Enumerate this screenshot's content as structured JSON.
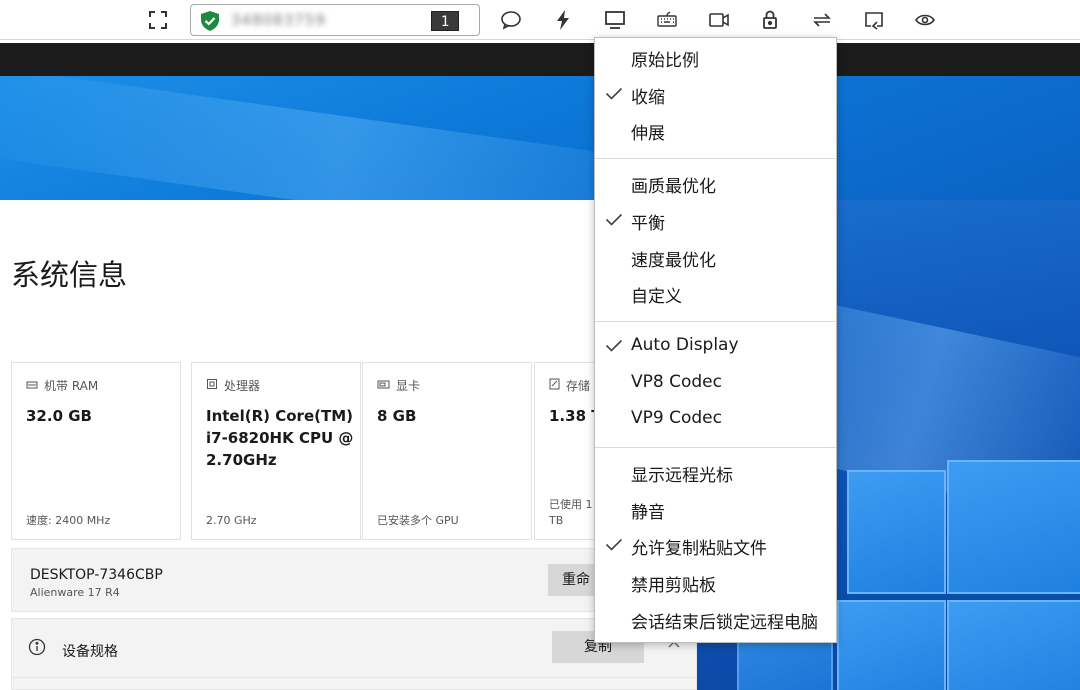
{
  "toolbar": {
    "peer_id": "348083759",
    "display_count": "1"
  },
  "settings": {
    "title": "系统信息",
    "cards": [
      {
        "head": "机带 RAM",
        "value": "32.0 GB",
        "foot": "速度: 2400 MHz"
      },
      {
        "head": "处理器",
        "value": "Intel(R) Core(TM) i7-6820HK CPU @ 2.70GHz",
        "foot": "2.70 GHz"
      },
      {
        "head": "显卡",
        "value": "8 GB",
        "foot": "已安装多个 GPU"
      },
      {
        "head": "存储",
        "value": "1.38 T",
        "foot": "已使用 1 TB"
      }
    ],
    "device": {
      "name": "DESKTOP-7346CBP",
      "model": "Alienware 17 R4",
      "rename_button": "重命"
    },
    "spec": {
      "label": "设备规格",
      "copy_button": "复制"
    }
  },
  "menu": {
    "groups": [
      [
        {
          "label": "原始比例",
          "checked": false
        },
        {
          "label": "收缩",
          "checked": true
        },
        {
          "label": "伸展",
          "checked": false
        }
      ],
      [
        {
          "label": "画质最优化",
          "checked": false
        },
        {
          "label": "平衡",
          "checked": true
        },
        {
          "label": "速度最优化",
          "checked": false
        },
        {
          "label": "自定义",
          "checked": false
        }
      ],
      [
        {
          "label": "Auto Display",
          "checked": true
        },
        {
          "label": "VP8 Codec",
          "checked": false
        },
        {
          "label": "VP9 Codec",
          "checked": false
        }
      ],
      [
        {
          "label": "显示远程光标",
          "checked": false
        },
        {
          "label": "静音",
          "checked": false
        },
        {
          "label": "允许复制粘贴文件",
          "checked": true
        },
        {
          "label": "禁用剪贴板",
          "checked": false
        },
        {
          "label": "会话结束后锁定远程电脑",
          "checked": false
        }
      ]
    ]
  },
  "colors": {
    "shield": "#1e8a3e",
    "banner": "#0c78d8",
    "desktop": "#0f56b8"
  }
}
